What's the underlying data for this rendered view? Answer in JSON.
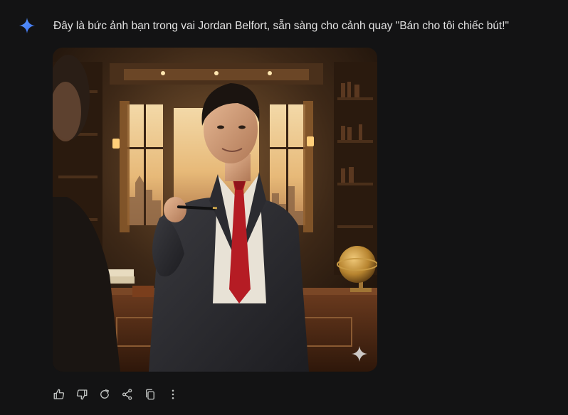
{
  "message": {
    "text": "Đây là bức ảnh bạn trong vai Jordan Belfort, sẵn sàng cho cảnh quay \"Bán cho tôi chiếc bút!\"",
    "assistant_icon": "gemini-sparkle-icon"
  },
  "image": {
    "subject": "man-in-suit-holding-pen-office",
    "badge_icon": "ai-sparkle-icon"
  },
  "actions": [
    {
      "icon": "thumbs-up-icon"
    },
    {
      "icon": "thumbs-down-icon"
    },
    {
      "icon": "regenerate-icon"
    },
    {
      "icon": "share-icon"
    },
    {
      "icon": "copy-icon"
    },
    {
      "icon": "more-options-icon"
    }
  ],
  "colors": {
    "background": "#131314",
    "text": "#e3e3e3",
    "icon": "#c4c7c5",
    "accent_blue": "#4285f4"
  }
}
